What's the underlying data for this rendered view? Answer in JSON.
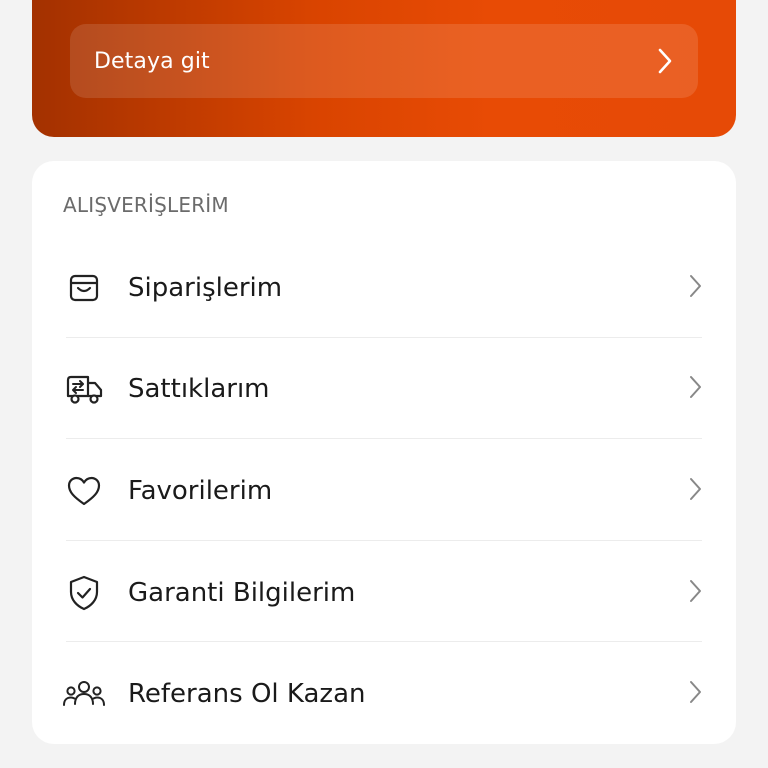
{
  "promo": {
    "detail_label": "Detaya git"
  },
  "section": {
    "title": "ALIŞVERİŞLERİM"
  },
  "menu": {
    "items": [
      {
        "label": "Siparişlerim",
        "icon": "shopping-bag-icon"
      },
      {
        "label": "Sattıklarım",
        "icon": "exchange-truck-icon"
      },
      {
        "label": "Favorilerim",
        "icon": "heart-icon"
      },
      {
        "label": "Garanti Bilgilerim",
        "icon": "shield-check-icon"
      },
      {
        "label": "Referans Ol Kazan",
        "icon": "people-icon"
      }
    ]
  },
  "colors": {
    "accent": "#e64a06",
    "accent_dark": "#a33100",
    "background": "#f3f3f3",
    "card": "#ffffff"
  }
}
